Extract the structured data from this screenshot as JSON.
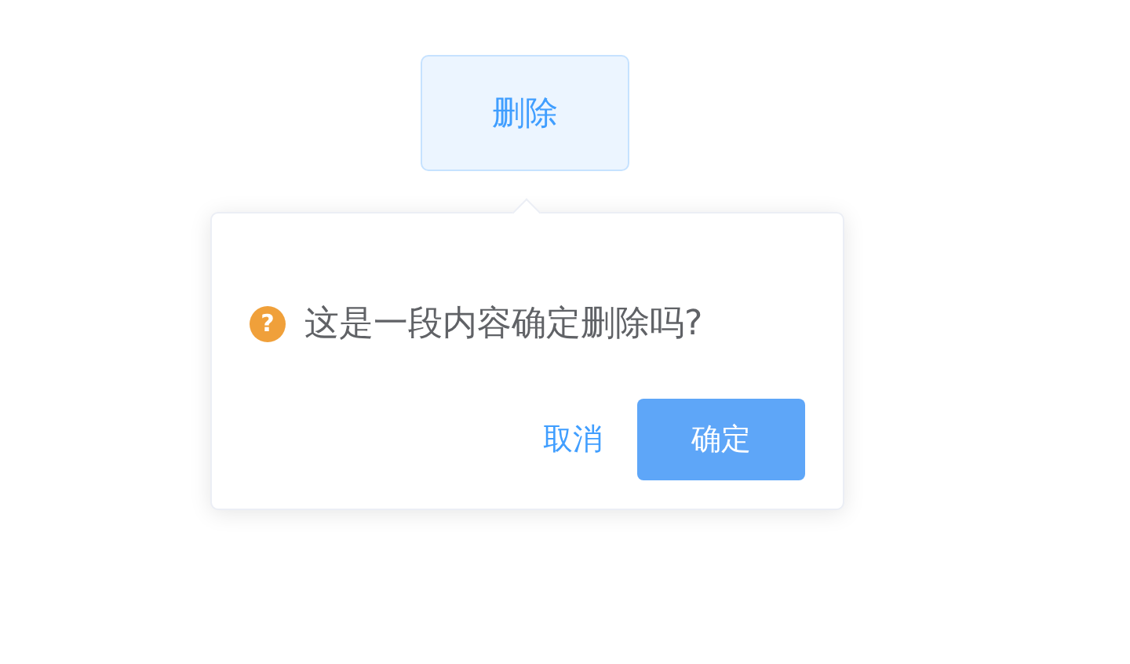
{
  "trigger_button": {
    "label": "删除"
  },
  "popconfirm": {
    "icon": "?",
    "message": "这是一段内容确定删除吗?",
    "buttons": [
      {
        "label": "取消",
        "kind": "text"
      },
      {
        "label": "确定",
        "kind": "primary"
      }
    ]
  }
}
